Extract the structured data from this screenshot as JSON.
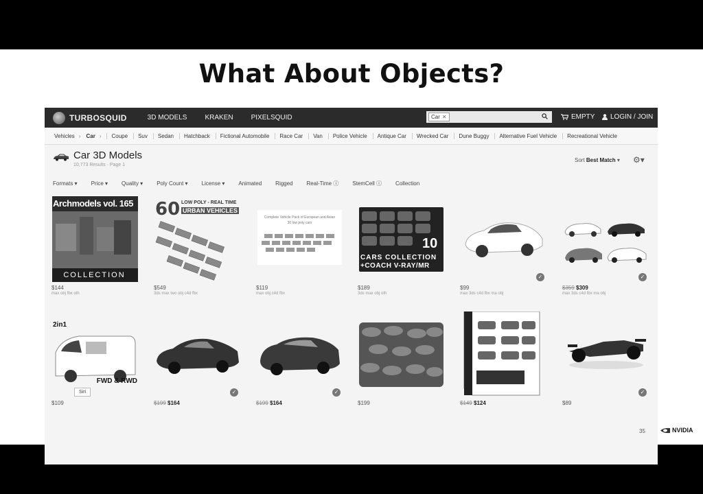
{
  "slide": {
    "title": "What About Objects?",
    "page_number": "35",
    "logo_text": "NVIDIA"
  },
  "topbar": {
    "brand": "TURBOSQUID",
    "nav": [
      "3D MODELS",
      "KRAKEN",
      "PIXELSQUID"
    ],
    "search_chip": "Car",
    "cart_label": "EMPTY",
    "login_label": "LOGIN / JOIN"
  },
  "categories": {
    "breadcrumb": [
      "Vehicles",
      "Car"
    ],
    "items": [
      "Coupe",
      "Suv",
      "Sedan",
      "Hatchback",
      "Fictional Automobile",
      "Race Car",
      "Van",
      "Police Vehicle",
      "Antique Car",
      "Wrecked Car",
      "Dune Buggy",
      "Alternative Fuel Vehicle",
      "Recreational Vehicle"
    ]
  },
  "heading": {
    "title": "Car 3D Models",
    "results": "10,773 Results · Page 1",
    "sort_label": "Sort",
    "sort_value": "Best Match"
  },
  "filters": [
    "Formats ▾",
    "Price ▾",
    "Quality ▾",
    "Poly Count ▾",
    "License ▾",
    "Animated",
    "Rigged",
    "Real-Time ⓘ",
    "StemCell ⓘ",
    "Collection"
  ],
  "products": [
    {
      "old_price": "",
      "price": "$144",
      "formats": "max obj fbx oth",
      "check": false,
      "thumb_text": [
        "Archmodels vol. 165",
        "COLLECTION"
      ]
    },
    {
      "old_price": "",
      "price": "$549",
      "formats": "3ds max lwo obj c4d fbx",
      "check": false,
      "thumb_text": [
        "60",
        "LOW POLY - REAL TIME",
        "URBAN VEHICLES"
      ]
    },
    {
      "old_price": "",
      "price": "$119",
      "formats": "max obj c4d fbx",
      "check": false,
      "thumb_text": [
        "Complete Vehicle Pack of European and Asian",
        "30 low poly cars"
      ]
    },
    {
      "old_price": "",
      "price": "$189",
      "formats": "3ds max obj oth",
      "check": false,
      "thumb_text": [
        "10",
        "CARS COLLECTION",
        "+COACH V-RAY/MR"
      ]
    },
    {
      "old_price": "",
      "price": "$99",
      "formats": "max 3ds c4d fbx ma obj",
      "check": true,
      "thumb_text": []
    },
    {
      "old_price": "$359",
      "price": "$309",
      "formats": "max 3ds c4d fbx ma obj",
      "check": true,
      "thumb_text": []
    },
    {
      "old_price": "",
      "price": "$109",
      "formats": "",
      "check": false,
      "thumb_text": [
        "2in1",
        "FWD & RWD"
      ]
    },
    {
      "old_price": "$199",
      "price": "$164",
      "formats": "",
      "check": true,
      "thumb_text": []
    },
    {
      "old_price": "$199",
      "price": "$164",
      "formats": "",
      "check": true,
      "thumb_text": []
    },
    {
      "old_price": "",
      "price": "$199",
      "formats": "",
      "check": false,
      "thumb_text": []
    },
    {
      "old_price": "$149",
      "price": "$124",
      "formats": "",
      "check": false,
      "thumb_text": []
    },
    {
      "old_price": "",
      "price": "$89",
      "formats": "",
      "check": true,
      "thumb_text": []
    }
  ],
  "siri_label": "Siri",
  "icons": [
    "turbosquid-logo-icon",
    "search-icon",
    "cart-icon",
    "user-icon",
    "car-icon",
    "gear-icon",
    "check-icon",
    "nvidia-logo-icon"
  ]
}
